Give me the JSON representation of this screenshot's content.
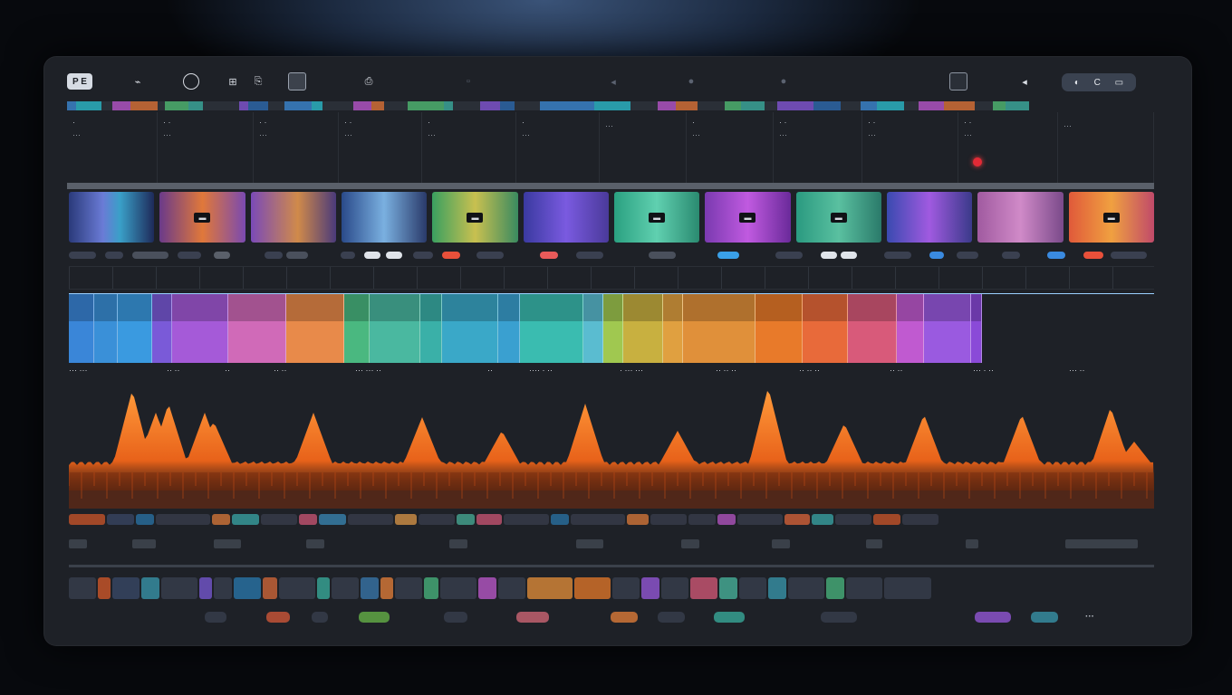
{
  "toolbar": {
    "badge": "P E",
    "items": [
      "⌁",
      "⊖",
      "⊞",
      "⎘",
      "▣",
      "⎙",
      "▭",
      "◂"
    ],
    "right_group": [
      "◐",
      "C",
      "▭"
    ]
  },
  "tracks_header": [
    {
      "l1": "·",
      "l2": "···"
    },
    {
      "l1": "· ·",
      "l2": "···"
    },
    {
      "l1": "· ·",
      "l2": "···"
    },
    {
      "l1": "· ·",
      "l2": "···"
    },
    {
      "l1": "·",
      "l2": "···"
    },
    {
      "l1": "·",
      "l2": "···"
    },
    {
      "l1": "",
      "l2": "···"
    },
    {
      "l1": "·",
      "l2": "···"
    },
    {
      "l1": "· ·",
      "l2": "···"
    },
    {
      "l1": "· ·",
      "l2": "···"
    },
    {
      "l1": "· ·",
      "l2": "···"
    },
    {
      "l1": "",
      "l2": "···"
    }
  ],
  "thumbnails": [
    {
      "tag": ""
    },
    {
      "tag": "▬"
    },
    {
      "tag": ""
    },
    {
      "tag": ""
    },
    {
      "tag": "▬"
    },
    {
      "tag": ""
    },
    {
      "tag": "▬"
    },
    {
      "tag": "▬"
    },
    {
      "tag": "▬"
    },
    {
      "tag": ""
    },
    {
      "tag": ""
    },
    {
      "tag": "▬"
    }
  ],
  "clip_labels": [
    "··· ···",
    "·· ··",
    "··",
    "·· ··",
    "··· ··· ··",
    "··",
    "···· · ··",
    "· ··· ···",
    "·· ·· ··",
    "·· ·· ··",
    "·· ··",
    "··· · ··",
    "··· ··"
  ],
  "footer": {
    "right_text": "···"
  },
  "colors": {
    "window_bg": "#1e2127",
    "audio_wave": "#f07a26",
    "record_dot": "#e22a36"
  }
}
